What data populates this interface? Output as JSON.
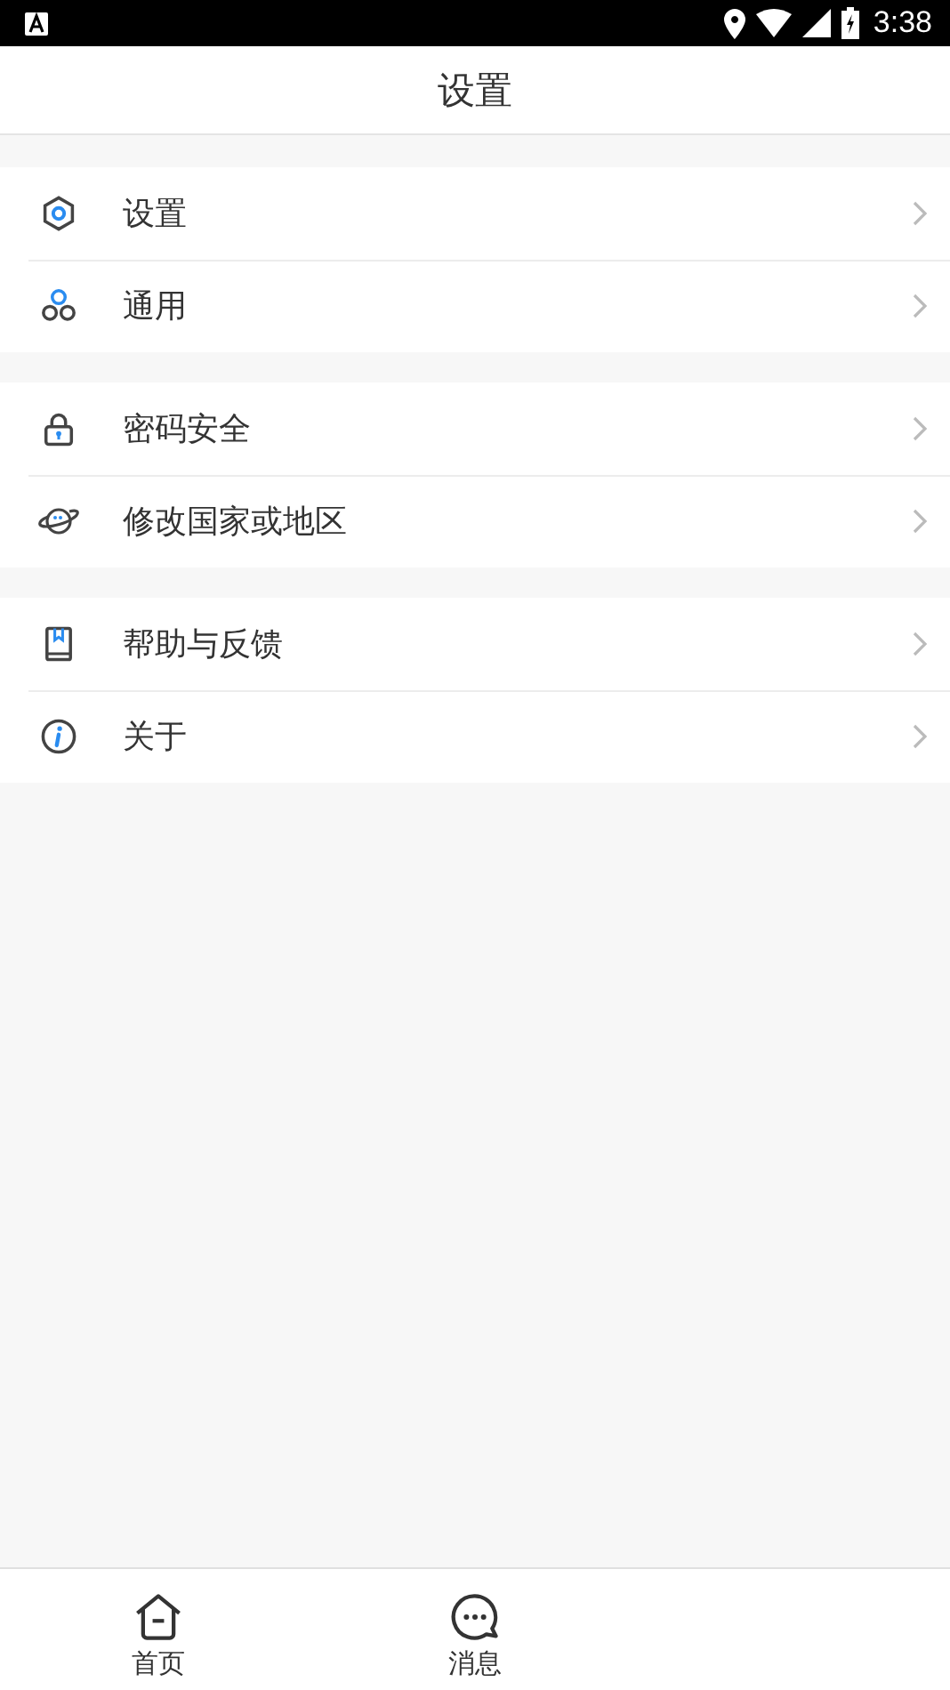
{
  "status_bar": {
    "time": "3:38"
  },
  "header": {
    "title": "设置"
  },
  "groups": [
    {
      "items": [
        {
          "label": "设置"
        },
        {
          "label": "通用"
        }
      ]
    },
    {
      "items": [
        {
          "label": "密码安全"
        },
        {
          "label": "修改国家或地区"
        }
      ]
    },
    {
      "items": [
        {
          "label": "帮助与反馈"
        },
        {
          "label": "关于"
        }
      ]
    }
  ],
  "bottom_nav": [
    {
      "label": "首页"
    },
    {
      "label": "消息"
    }
  ]
}
